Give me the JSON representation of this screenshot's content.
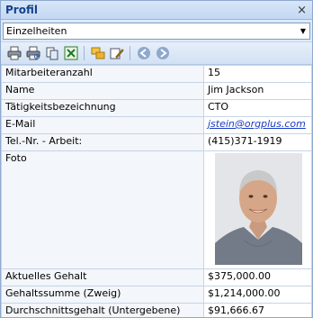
{
  "panel": {
    "title": "Profil",
    "close_glyph": "×"
  },
  "view_select": {
    "value": "Einzelheiten"
  },
  "toolbar": {
    "icons": [
      "print-icon",
      "print-preview-icon",
      "copy-icon",
      "excel-export-icon",
      "org-chart-icon",
      "edit-icon",
      "back-icon",
      "forward-icon"
    ]
  },
  "rows": [
    {
      "label": "Mitarbeiteranzahl",
      "value": "15"
    },
    {
      "label": "Name",
      "value": "Jim Jackson"
    },
    {
      "label": "Tätigkeitsbezeichnung",
      "value": "CTO"
    },
    {
      "label": "E-Mail",
      "value": "jstein@orgplus.com"
    },
    {
      "label": "Tel.-Nr. - Arbeit:",
      "value": "(415)371-1919"
    },
    {
      "label": "Foto",
      "value": ""
    },
    {
      "label": "Aktuelles Gehalt",
      "value": "$375,000.00"
    },
    {
      "label": "Gehaltssumme (Zweig)",
      "value": "$1,214,000.00"
    },
    {
      "label": "Durchschnittsgehalt (Untergebene)",
      "value": "$91,666.67"
    }
  ],
  "colors": {
    "title_text": "#15428b",
    "link": "#1a3cc4",
    "border": "#8fa9cf"
  }
}
